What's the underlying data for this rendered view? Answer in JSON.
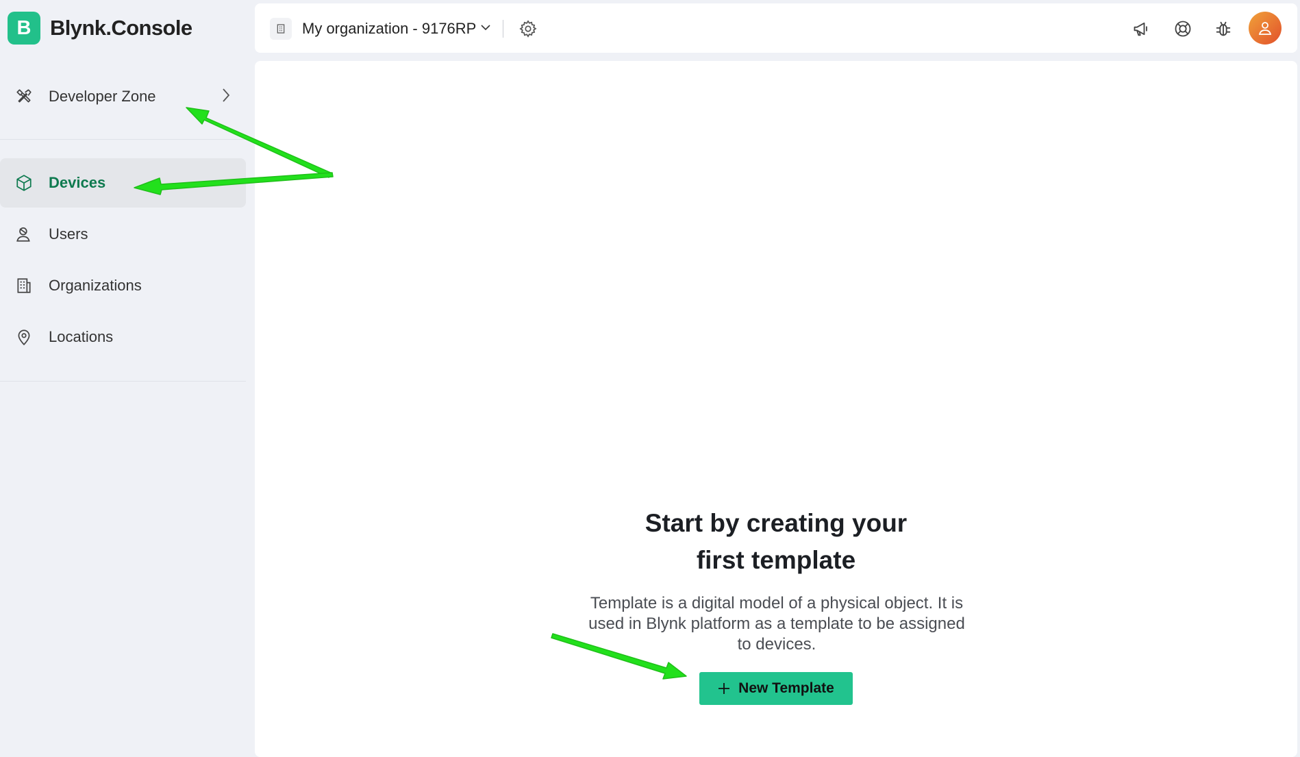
{
  "brand": {
    "logo_letter": "B",
    "name": "Blynk.Console"
  },
  "sidebar": {
    "developer_zone": {
      "label": "Developer Zone",
      "icon": "tools-icon"
    },
    "items": [
      {
        "label": "Devices",
        "icon": "cube-icon",
        "active": true
      },
      {
        "label": "Users",
        "icon": "user-icon"
      },
      {
        "label": "Organizations",
        "icon": "building-icon"
      },
      {
        "label": "Locations",
        "icon": "map-pin-icon"
      }
    ]
  },
  "header": {
    "org_name": "My organization - 9176RP",
    "icons": [
      "megaphone-icon",
      "help-lifebuoy-icon",
      "bug-icon",
      "avatar"
    ]
  },
  "main": {
    "title_line1": "Start by creating your",
    "title_line2": "first template",
    "description": "Template is a digital model of a physical object. It is used in Blynk platform as a template to be assigned to devices.",
    "new_template_label": "New Template"
  },
  "colors": {
    "accent": "#22c38e",
    "active_text": "#0e7a4f",
    "arrow": "#22e01c",
    "background": "#eff1f6"
  }
}
